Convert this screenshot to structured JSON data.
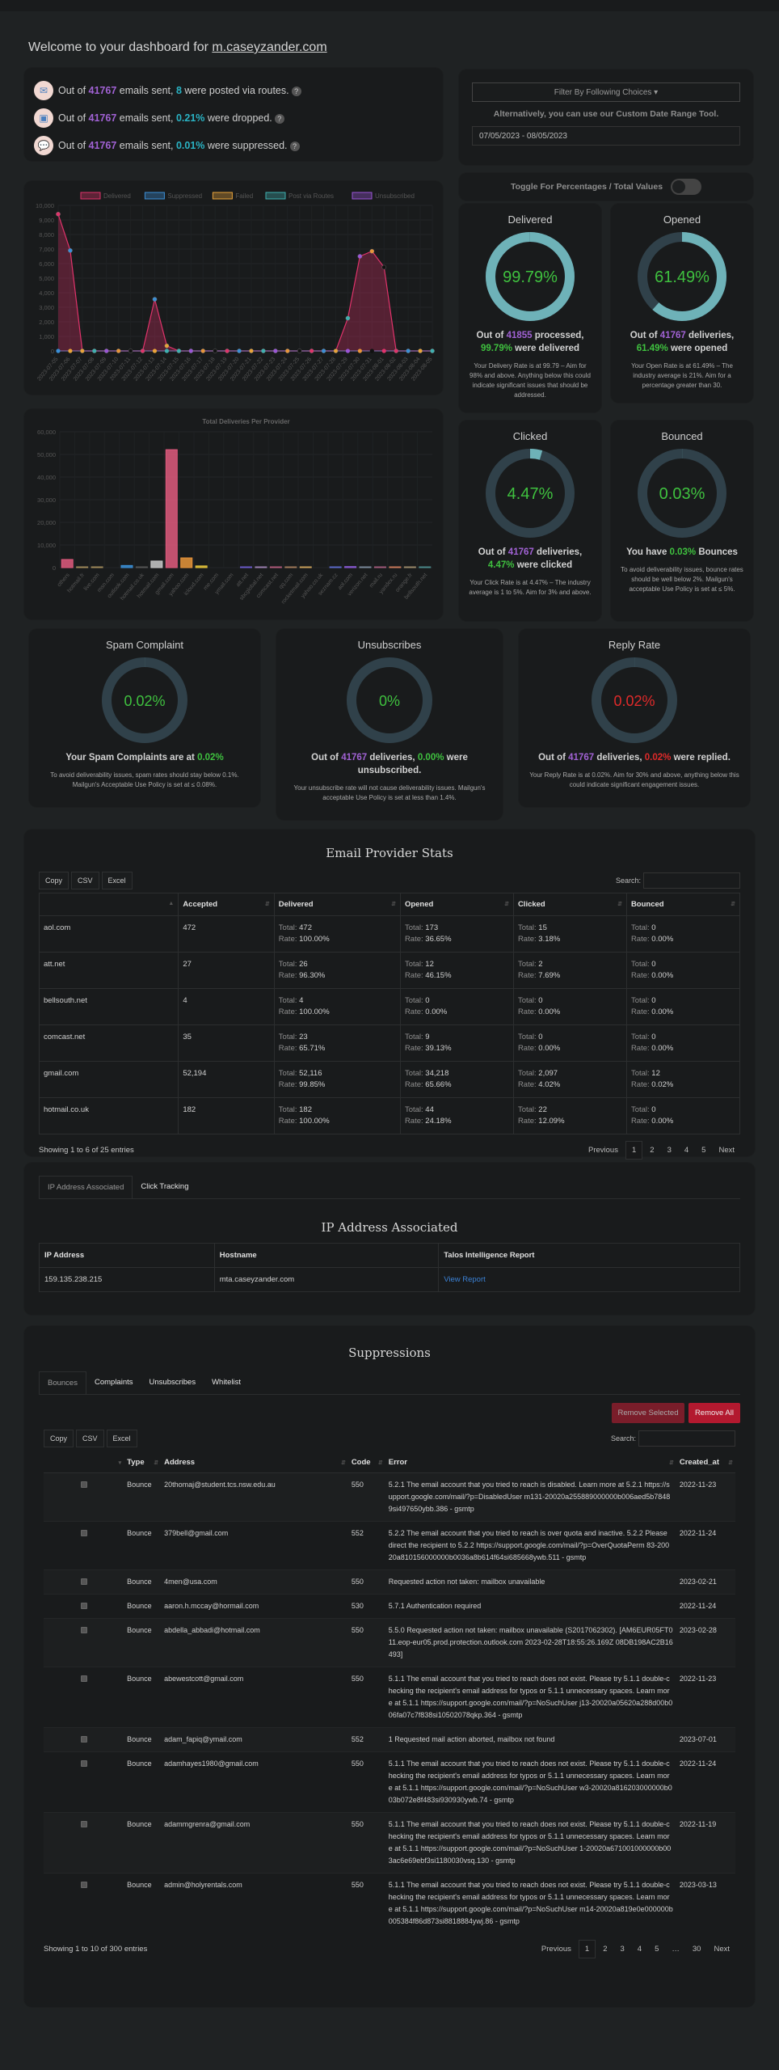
{
  "header": {
    "welcome_prefix": "Welcome to your dashboard for ",
    "domain": "m.caseyzander.com"
  },
  "summary": [
    {
      "icon": "envelope-icon",
      "pre": "Out of ",
      "total": "41767",
      "mid": " emails sent, ",
      "value": "8",
      "post": " were posted via routes."
    },
    {
      "icon": "dropped-icon",
      "pre": "Out of ",
      "total": "41767",
      "mid": " emails sent, ",
      "value": "0.21%",
      "post": " were dropped."
    },
    {
      "icon": "speech-bubble-icon",
      "pre": "Out of ",
      "total": "41767",
      "mid": " emails sent, ",
      "value": "0.01%",
      "post": " were suppressed."
    }
  ],
  "filter": {
    "dropdown_label": "Filter By Following Choices",
    "alt_text": "Alternatively, you can use our Custom Date Range Tool.",
    "date_range": "07/05/2023 - 08/05/2023",
    "toggle_label": "Toggle For Percentages / Total Values",
    "toggle_on": false
  },
  "chart_data": [
    {
      "type": "area",
      "title": "",
      "legend_position": "top",
      "legend": [
        "Delivered",
        "Suppressed",
        "Failed",
        "Post via Routes",
        "Unsubscribed"
      ],
      "series_colors": {
        "Delivered": "#e0336b",
        "Suppressed": "#3b8fd6",
        "Failed": "#e8a33a",
        "Post via Routes": "#3fb0b0",
        "Unsubscribed": "#9a55d6"
      },
      "x": [
        "2023-07-05",
        "2023-07-06",
        "2023-07-07",
        "2023-07-08",
        "2023-07-09",
        "2023-07-10",
        "2023-07-11",
        "2023-07-12",
        "2023-07-13",
        "2023-07-14",
        "2023-07-15",
        "2023-07-16",
        "2023-07-17",
        "2023-07-18",
        "2023-07-19",
        "2023-07-20",
        "2023-07-21",
        "2023-07-22",
        "2023-07-23",
        "2023-07-24",
        "2023-07-25",
        "2023-07-26",
        "2023-07-27",
        "2023-07-28",
        "2023-07-29",
        "2023-07-30",
        "2023-07-31",
        "2023-08-01",
        "2023-08-02",
        "2023-08-03",
        "2023-08-04",
        "2023-08-05"
      ],
      "series": [
        {
          "name": "Delivered",
          "values": [
            9400,
            6900,
            0,
            0,
            0,
            0,
            0,
            0,
            3550,
            350,
            0,
            0,
            0,
            0,
            0,
            0,
            0,
            0,
            0,
            0,
            0,
            0,
            0,
            0,
            2250,
            6500,
            6850,
            5750,
            0,
            0,
            0,
            0
          ]
        },
        {
          "name": "Suppressed",
          "values": [
            0,
            0,
            0,
            0,
            0,
            0,
            0,
            0,
            0,
            0,
            0,
            0,
            0,
            0,
            0,
            0,
            0,
            0,
            0,
            0,
            0,
            0,
            0,
            0,
            0,
            0,
            0,
            0,
            0,
            0,
            0,
            0
          ]
        },
        {
          "name": "Failed",
          "values": [
            0,
            0,
            0,
            0,
            0,
            0,
            0,
            0,
            0,
            0,
            0,
            0,
            0,
            0,
            0,
            0,
            0,
            0,
            0,
            0,
            0,
            0,
            0,
            0,
            0,
            0,
            0,
            0,
            0,
            0,
            0,
            0
          ]
        },
        {
          "name": "Post via Routes",
          "values": [
            0,
            0,
            0,
            0,
            0,
            0,
            0,
            0,
            0,
            0,
            0,
            0,
            0,
            0,
            0,
            0,
            0,
            0,
            0,
            0,
            0,
            0,
            0,
            0,
            0,
            0,
            0,
            0,
            0,
            0,
            0,
            0
          ]
        },
        {
          "name": "Unsubscribed",
          "values": [
            0,
            0,
            0,
            0,
            0,
            0,
            0,
            0,
            0,
            0,
            0,
            0,
            0,
            0,
            0,
            0,
            0,
            0,
            0,
            0,
            0,
            0,
            0,
            0,
            0,
            0,
            0,
            0,
            0,
            0,
            0,
            0
          ]
        }
      ],
      "ylim": [
        0,
        10000
      ],
      "yticks": [
        "0",
        "1,000",
        "2,000",
        "3,000",
        "4,000",
        "5,000",
        "6,000",
        "7,000",
        "8,000",
        "9,000",
        "10,000"
      ],
      "grid": true
    },
    {
      "type": "bar",
      "title": "Total Deliveries Per Provider",
      "categories": [
        "others",
        "hotmail.fr",
        "live.com",
        "msn.com",
        "outlook.com",
        "hotmail.co.uk",
        "hotmail.com",
        "gmail.com",
        "yahoo.com",
        "icloud.com",
        "me.com",
        "ymail.com",
        "att.net",
        "sbcglobal.net",
        "comcast.net",
        "qq.com",
        "rocketmail.com",
        "yahoo.co.uk",
        "seznam.cz",
        "aol.com",
        "verizon.net",
        "mail.ru",
        "yandex.ru",
        "orange.fr",
        "bellsouth.net"
      ],
      "values": [
        3600,
        250,
        350,
        0,
        950,
        182,
        2900,
        52116,
        4300,
        750,
        0,
        0,
        26,
        80,
        23,
        60,
        90,
        0,
        20,
        472,
        60,
        40,
        50,
        30,
        4
      ],
      "colors": [
        "#e05a7e",
        "#a08a5a",
        "#a08a5a",
        "#888",
        "#3b8fd6",
        "#555",
        "#c9c9c9",
        "#e05a7e",
        "#e8953a",
        "#e8c63a",
        "#888",
        "#888",
        "#6a5ac9",
        "#9a7fb0",
        "#b05a7a",
        "#a07a5a",
        "#c9a05a",
        "#888",
        "#5a6ac9",
        "#8a5ad6",
        "#7a8a9a",
        "#a05a7a",
        "#c97a5a",
        "#9a8a6a",
        "#4a8a8a"
      ],
      "ylim": [
        0,
        60000
      ],
      "yticks": [
        "0",
        "10,000",
        "20,000",
        "30,000",
        "40,000",
        "50,000",
        "60,000"
      ],
      "grid": true
    }
  ],
  "gauges": [
    {
      "id": "delivered",
      "title": "Delivered",
      "percent": 99.79,
      "value_label": "99.79%",
      "value_color": "green",
      "desc_pre": "Out of ",
      "desc_num": "41855",
      "desc_mid": " processed,",
      "desc_pct": "99.79%",
      "desc_post": " were delivered",
      "note": "Your Delivery Rate is at 99.79 – Aim for 98% and above. Anything below this could indicate significant issues that should be addressed."
    },
    {
      "id": "opened",
      "title": "Opened",
      "percent": 61.49,
      "value_label": "61.49%",
      "value_color": "green",
      "desc_pre": "Out of ",
      "desc_num": "41767",
      "desc_mid": " deliveries,",
      "desc_pct": "61.49%",
      "desc_post": " were opened",
      "note": "Your Open Rate is at 61.49% – The industry average is 21%. Aim for a percentage greater than 30."
    },
    {
      "id": "clicked",
      "title": "Clicked",
      "percent": 4.47,
      "value_label": "4.47%",
      "value_color": "green",
      "desc_pre": "Out of ",
      "desc_num": "41767",
      "desc_mid": " deliveries,",
      "desc_pct": "4.47%",
      "desc_post": " were clicked",
      "note": "Your Click Rate is at 4.47% – The industry average is 1 to 5%. Aim for 3% and above."
    },
    {
      "id": "bounced",
      "title": "Bounced",
      "percent": 0.03,
      "value_label": "0.03%",
      "value_color": "green",
      "desc_pre": "You have ",
      "desc_pct": "0.03%",
      "desc_post": " Bounces",
      "note": "To avoid deliverability issues, bounce rates should be well below 2%. Mailgun's acceptable Use Policy is set at ≤ 5%."
    },
    {
      "id": "spam",
      "title": "Spam Complaint",
      "percent": 0.02,
      "value_label": "0.02%",
      "value_color": "green",
      "desc_pre": "Your Spam Complaints are at ",
      "desc_pct": "0.02%",
      "desc_post": "",
      "note": "To avoid deliverability issues, spam rates should stay below 0.1%. Mailgun's Acceptable Use Policy is set at ≤ 0.08%."
    },
    {
      "id": "unsub",
      "title": "Unsubscribes",
      "percent": 0,
      "value_label": "0%",
      "value_color": "green",
      "desc_pre": "Out of ",
      "desc_num": "41767",
      "desc_mid": " deliveries, ",
      "desc_pct": "0.00%",
      "desc_post": " were unsubscribed.",
      "note": "Your unsubscribe rate will not cause deliverability issues. Mailgun's acceptable Use Policy is set at less than 1.4%."
    },
    {
      "id": "reply",
      "title": "Reply Rate",
      "percent": 0.02,
      "value_label": "0.02%",
      "value_color": "red",
      "desc_pre": "Out of ",
      "desc_num": "41767",
      "desc_mid": " deliveries, ",
      "desc_pct": "0.02%",
      "desc_post": " were replied.",
      "note": "Your Reply Rate is at 0.02%. Aim for 30% and above, anything below this could indicate significant engagement issues."
    }
  ],
  "provider_stats": {
    "title": "Email Provider Stats",
    "buttons": [
      "Copy",
      "CSV",
      "Excel"
    ],
    "search_label": "Search:",
    "columns": [
      "",
      "Accepted",
      "Delivered",
      "Opened",
      "Clicked",
      "Bounced"
    ],
    "total_label": "Total:",
    "rate_label": "Rate:",
    "rows": [
      {
        "provider": "aol.com",
        "accepted": "472",
        "delivered": [
          "472",
          "100.00%"
        ],
        "opened": [
          "173",
          "36.65%"
        ],
        "clicked": [
          "15",
          "3.18%"
        ],
        "bounced": [
          "0",
          "0.00%"
        ]
      },
      {
        "provider": "att.net",
        "accepted": "27",
        "delivered": [
          "26",
          "96.30%"
        ],
        "opened": [
          "12",
          "46.15%"
        ],
        "clicked": [
          "2",
          "7.69%"
        ],
        "bounced": [
          "0",
          "0.00%"
        ]
      },
      {
        "provider": "bellsouth.net",
        "accepted": "4",
        "delivered": [
          "4",
          "100.00%"
        ],
        "opened": [
          "0",
          "0.00%"
        ],
        "clicked": [
          "0",
          "0.00%"
        ],
        "bounced": [
          "0",
          "0.00%"
        ]
      },
      {
        "provider": "comcast.net",
        "accepted": "35",
        "delivered": [
          "23",
          "65.71%"
        ],
        "opened": [
          "9",
          "39.13%"
        ],
        "clicked": [
          "0",
          "0.00%"
        ],
        "bounced": [
          "0",
          "0.00%"
        ]
      },
      {
        "provider": "gmail.com",
        "accepted": "52,194",
        "delivered": [
          "52,116",
          "99.85%"
        ],
        "opened": [
          "34,218",
          "65.66%"
        ],
        "clicked": [
          "2,097",
          "4.02%"
        ],
        "bounced": [
          "12",
          "0.02%"
        ]
      },
      {
        "provider": "hotmail.co.uk",
        "accepted": "182",
        "delivered": [
          "182",
          "100.00%"
        ],
        "opened": [
          "44",
          "24.18%"
        ],
        "clicked": [
          "22",
          "12.09%"
        ],
        "bounced": [
          "0",
          "0.00%"
        ]
      }
    ],
    "info": "Showing 1 to 6 of 25 entries",
    "pagination": [
      "Previous",
      "1",
      "2",
      "3",
      "4",
      "5",
      "Next"
    ],
    "current_page": "1"
  },
  "ip_section": {
    "tabs": [
      "IP Address Associated",
      "Click Tracking"
    ],
    "active_tab": 0,
    "title": "IP Address Associated",
    "columns": [
      "IP Address",
      "Hostname",
      "Talos Intelligence Report"
    ],
    "rows": [
      {
        "ip": "159.135.238.215",
        "hostname": "mta.caseyzander.com",
        "report": "View Report"
      }
    ]
  },
  "suppressions": {
    "title": "Suppressions",
    "tabs": [
      "Bounces",
      "Complaints",
      "Unsubscribes",
      "Whitelist"
    ],
    "active_tab": 0,
    "remove_selected": "Remove Selected",
    "remove_all": "Remove All",
    "buttons": [
      "Copy",
      "CSV",
      "Excel"
    ],
    "search_label": "Search:",
    "columns": [
      "",
      "Type",
      "Address",
      "Code",
      "Error",
      "Created_at"
    ],
    "rows": [
      {
        "type": "Bounce",
        "address": "20thomaj@student.tcs.nsw.edu.au",
        "code": "550",
        "error": "5.2.1 The email account that you tried to reach is disabled. Learn more at 5.2.1 https://support.google.com/mail/?p=DisabledUser m131-20020a255889000000b006aed5b78489si497650ybb.386 - gsmtp",
        "created": "2022-11-23"
      },
      {
        "type": "Bounce",
        "address": "379bell@gmail.com",
        "code": "552",
        "error": "5.2.2 The email account that you tried to reach is over quota and inactive. 5.2.2 Please direct the recipient to 5.2.2 https://support.google.com/mail/?p=OverQuotaPerm 83-20020a810156000000b0036a8b614f64si685668ywb.511 - gsmtp",
        "created": "2022-11-24"
      },
      {
        "type": "Bounce",
        "address": "4men@usa.com",
        "code": "550",
        "error": "Requested action not taken: mailbox unavailable",
        "created": "2023-02-21"
      },
      {
        "type": "Bounce",
        "address": "aaron.h.mccay@hormail.com",
        "code": "530",
        "error": "5.7.1 Authentication required",
        "created": "2022-11-24"
      },
      {
        "type": "Bounce",
        "address": "abdella_abbadi@hotmail.com",
        "code": "550",
        "error": "5.5.0 Requested action not taken: mailbox unavailable (S2017062302). [AM6EUR05FT011.eop-eur05.prod.protection.outlook.com 2023-02-28T18:55:26.169Z 08DB198AC2B16493]",
        "created": "2023-02-28"
      },
      {
        "type": "Bounce",
        "address": "abewestcott@gmail.com",
        "code": "550",
        "error": "5.1.1 The email account that you tried to reach does not exist. Please try 5.1.1 double-checking the recipient's email address for typos or 5.1.1 unnecessary spaces. Learn more at 5.1.1 https://support.google.com/mail/?p=NoSuchUser j13-20020a05620a288d00b006fa07c7f838si10502078qkp.364 - gsmtp",
        "created": "2022-11-23"
      },
      {
        "type": "Bounce",
        "address": "adam_fapiq@ymail.com",
        "code": "552",
        "error": "1 Requested mail action aborted, mailbox not found",
        "created": "2023-07-01"
      },
      {
        "type": "Bounce",
        "address": "adamhayes1980@gmail.com",
        "code": "550",
        "error": "5.1.1 The email account that you tried to reach does not exist. Please try 5.1.1 double-checking the recipient's email address for typos or 5.1.1 unnecessary spaces. Learn more at 5.1.1 https://support.google.com/mail/?p=NoSuchUser w3-20020a816203000000b003b072e8f483si930930ywb.74 - gsmtp",
        "created": "2022-11-24"
      },
      {
        "type": "Bounce",
        "address": "adammgrenra@gmail.com",
        "code": "550",
        "error": "5.1.1 The email account that you tried to reach does not exist. Please try 5.1.1 double-checking the recipient's email address for typos or 5.1.1 unnecessary spaces. Learn more at 5.1.1 https://support.google.com/mail/?p=NoSuchUser 1-20020a671001000000b003ac6e69ebf3si1180030vsq.130 - gsmtp",
        "created": "2022-11-19"
      },
      {
        "type": "Bounce",
        "address": "admin@holyrentals.com",
        "code": "550",
        "error": "5.1.1 The email account that you tried to reach does not exist. Please try 5.1.1 double-checking the recipient's email address for typos or 5.1.1 unnecessary spaces. Learn more at 5.1.1 https://support.google.com/mail/?p=NoSuchUser m14-20020a819e0e000000b005384f86d873si8818884ywj.86 - gsmtp",
        "created": "2023-03-13"
      }
    ],
    "info": "Showing 1 to 10 of 300 entries",
    "pagination": [
      "Previous",
      "1",
      "2",
      "3",
      "4",
      "5",
      "…",
      "30",
      "Next"
    ],
    "current_page": "1"
  }
}
